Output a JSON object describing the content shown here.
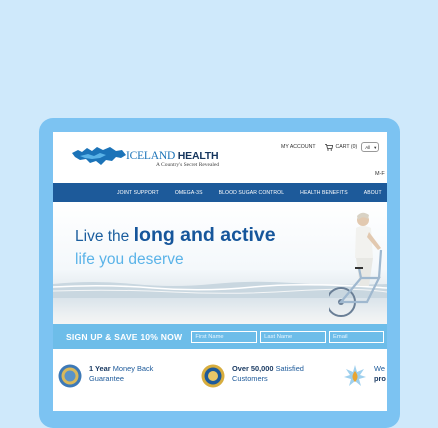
{
  "header": {
    "logo_primary": "ICELAND",
    "logo_secondary": "HEALTH",
    "logo_tagline": "A Country's Secret Revealed",
    "my_account": "MY ACCOUNT",
    "cart_label": "CART",
    "cart_count": "(0)",
    "cart_select_value": "All",
    "hours_text": "M-F"
  },
  "nav": {
    "items": [
      "JOINT SUPPORT",
      "OMEGA-3S",
      "BLOOD SUGAR CONTROL",
      "HEALTH BENEFITS",
      "ABOUT"
    ]
  },
  "hero": {
    "line1_prefix": "Live the ",
    "line1_emphasis": "long and active",
    "line2": "life you deserve"
  },
  "signup": {
    "title": "SIGN UP & SAVE 10% NOW",
    "first_name_placeholder": "First Name",
    "last_name_placeholder": "Last Name",
    "email_placeholder": "Email"
  },
  "features": [
    {
      "bold": "1 Year",
      "rest": " Money Back",
      "line2": "Guarantee"
    },
    {
      "bold": "Over 50,000",
      "rest": " Satisfied",
      "line2": "Customers"
    },
    {
      "bold": "",
      "rest": "We",
      "line2": "pro"
    }
  ],
  "colors": {
    "background": "#cfe9fb",
    "device_frame": "#7cc3f2",
    "nav_bar": "#1d5a9a",
    "signup_bar": "#6dbde9",
    "brand_dark": "#1b5e9e",
    "brand_light": "#5ab3e8"
  }
}
